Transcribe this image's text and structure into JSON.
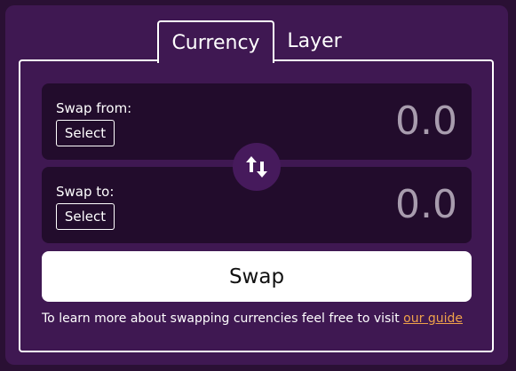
{
  "tabs": [
    {
      "label": "Currency",
      "active": true
    },
    {
      "label": "Layer",
      "active": false
    }
  ],
  "swap_from": {
    "label": "Swap from:",
    "select_label": "Select",
    "amount": "0.0"
  },
  "swap_to": {
    "label": "Swap to:",
    "select_label": "Select",
    "amount": "0.0"
  },
  "flip_icon": "swap-vertical-arrows-icon",
  "swap_button_label": "Swap",
  "footer": {
    "text": "To learn more about swapping currencies feel free to visit",
    "link_label": "our guide"
  },
  "colors": {
    "background": "#2a1034",
    "card": "#3f1852",
    "input_box": "#220c2c",
    "amount_text": "#a89cae",
    "link": "#f0a24a"
  }
}
